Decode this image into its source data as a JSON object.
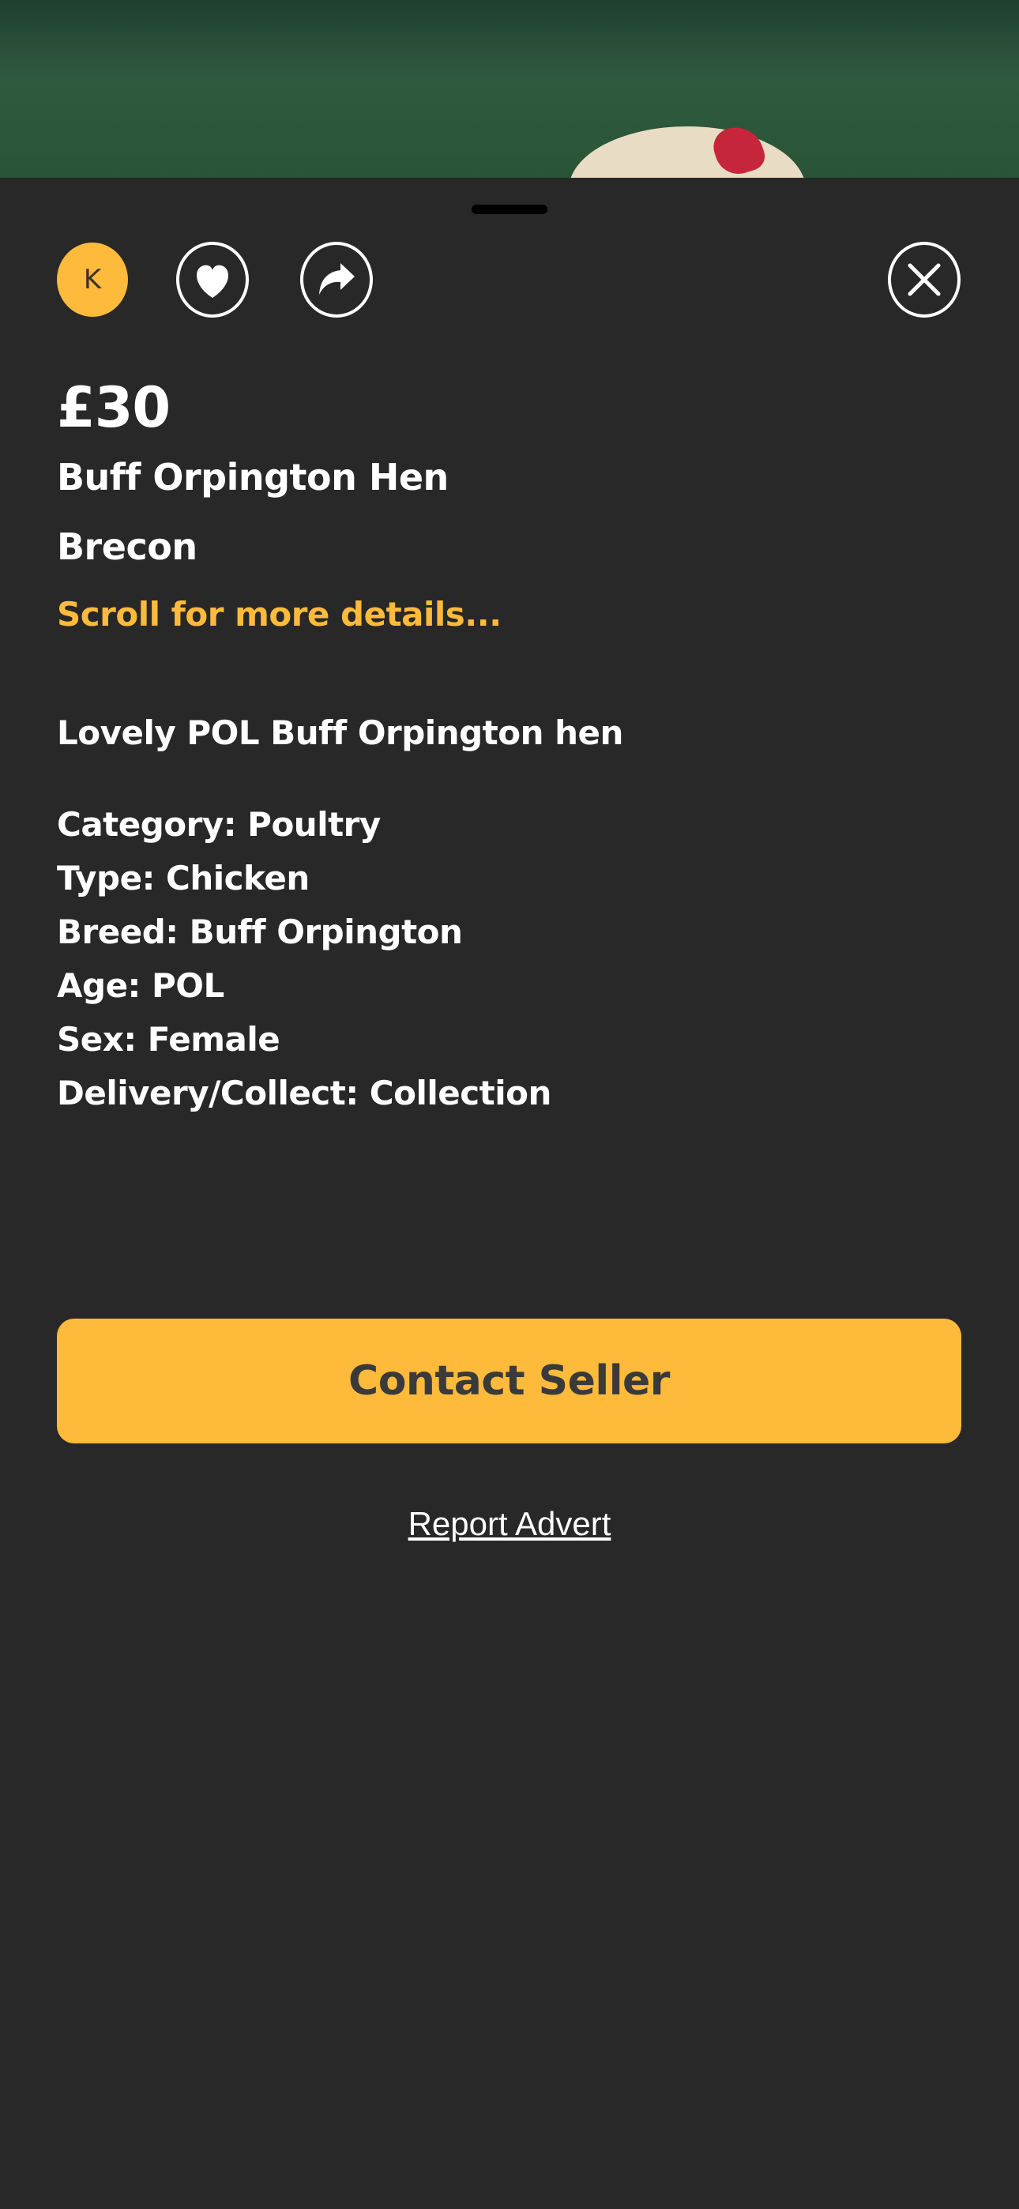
{
  "header": {
    "avatar_initial": "K",
    "favourite_icon": "heart-icon",
    "share_icon": "share-arrow-icon",
    "close_icon": "close-icon"
  },
  "listing": {
    "price": "£30",
    "title": "Buff Orpington Hen",
    "location": "Brecon",
    "scroll_hint": "Scroll for more details...",
    "description": "Lovely POL Buff Orpington hen",
    "details": [
      "Category: Poultry",
      "Type: Chicken",
      "Breed: Buff Orpington",
      "Age: POL",
      "Sex: Female",
      "Delivery/Collect: Collection"
    ]
  },
  "actions": {
    "contact_label": "Contact Seller",
    "report_label": "Report Advert"
  },
  "colors": {
    "accent": "#FDBA3B",
    "background": "#282828",
    "text": "#FFFFFF"
  }
}
